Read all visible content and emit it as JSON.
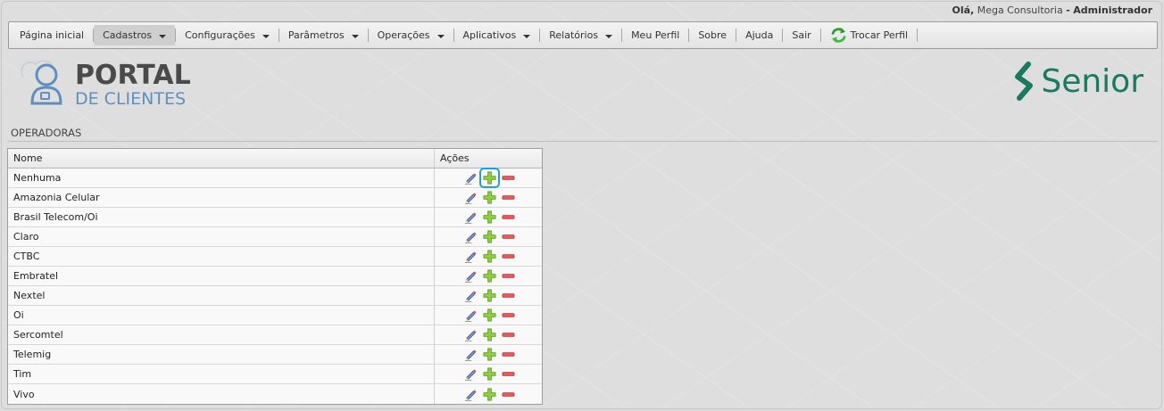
{
  "header": {
    "greeting": "Olá,",
    "user_name": "Mega Consultoria",
    "separator": "-",
    "role": "Administrador"
  },
  "menu": {
    "home": "Página inicial",
    "cadastros": "Cadastros",
    "configuracoes": "Configurações",
    "parametros": "Parâmetros",
    "operacoes": "Operações",
    "aplicativos": "Aplicativos",
    "relatorios": "Relatórios",
    "meu_perfil": "Meu Perfil",
    "sobre": "Sobre",
    "ajuda": "Ajuda",
    "sair": "Sair",
    "trocar_perfil": "Trocar Perfil"
  },
  "logo": {
    "portal": "PORTAL",
    "clientes": "DE CLIENTES",
    "brand": "Senior",
    "brand_color": "#1a7a60"
  },
  "page": {
    "section_title": "OPERADORAS"
  },
  "table": {
    "headers": {
      "name": "Nome",
      "actions": "Ações"
    },
    "rows": [
      {
        "name": "Nenhuma"
      },
      {
        "name": "Amazonia Celular"
      },
      {
        "name": "Brasil Telecom/Oi"
      },
      {
        "name": "Claro"
      },
      {
        "name": "CTBC"
      },
      {
        "name": "Embratel"
      },
      {
        "name": "Nextel"
      },
      {
        "name": "Oi"
      },
      {
        "name": "Sercomtel"
      },
      {
        "name": "Telemig"
      },
      {
        "name": "Tim"
      },
      {
        "name": "Vivo"
      }
    ],
    "action_icons": [
      "edit-icon",
      "add-icon",
      "remove-icon"
    ],
    "focus_color": "#1ba1d6"
  }
}
